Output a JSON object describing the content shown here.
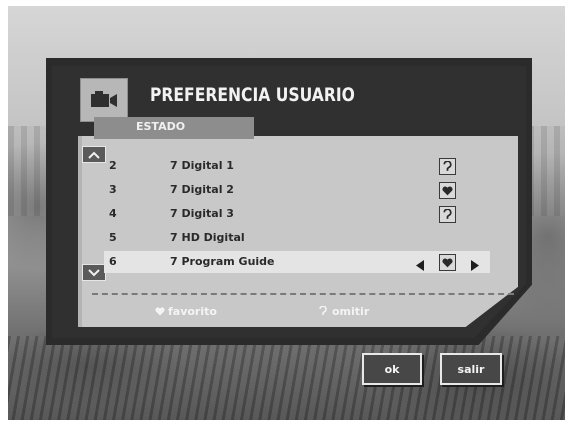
{
  "header": {
    "title": "PREFERENCIA USUARIO",
    "tab": "ESTADO",
    "icon": "camera-icon"
  },
  "channels": [
    {
      "number": "2",
      "name": "7 Digital 1",
      "status_icon": "skip-icon",
      "selected": false
    },
    {
      "number": "3",
      "name": "7 Digital 2",
      "status_icon": "heart-icon",
      "selected": false
    },
    {
      "number": "4",
      "name": "7 Digital 3",
      "status_icon": "skip-icon",
      "selected": false
    },
    {
      "number": "5",
      "name": "7 HD Digital",
      "status_icon": "",
      "selected": false
    },
    {
      "number": "6",
      "name": "7 Program Guide",
      "status_icon": "heart-icon",
      "selected": true
    }
  ],
  "legend": {
    "favorite": "favorito",
    "skip": "omitir"
  },
  "buttons": {
    "ok": "ok",
    "exit": "salir"
  }
}
